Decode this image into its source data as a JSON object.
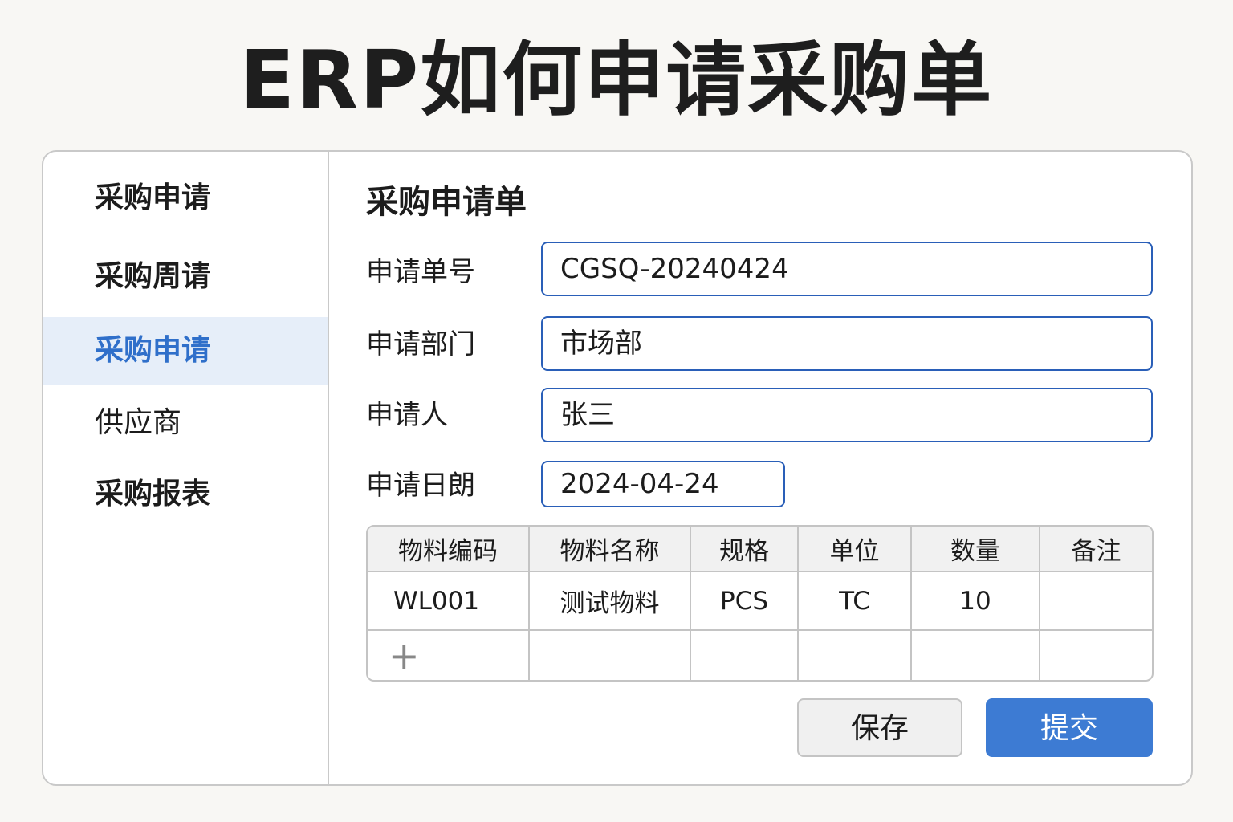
{
  "title": "ERP如何申请采购单",
  "sidebar": {
    "items": [
      {
        "label": "采购申请"
      },
      {
        "label": "采购周请"
      },
      {
        "label": "采购申请"
      },
      {
        "label": "供应商"
      },
      {
        "label": "采购报表"
      }
    ],
    "active_index": 2
  },
  "form": {
    "title": "采购申请单",
    "fields": [
      {
        "label": "申请单号",
        "value": "CGSQ-20240424"
      },
      {
        "label": "申请部门",
        "value": "市场部"
      },
      {
        "label": "申请人",
        "value": "张三"
      },
      {
        "label": "申请日朗",
        "value": "2024-04-24"
      }
    ],
    "table": {
      "headers": [
        "物料编码",
        "物料名称",
        "规格",
        "单位",
        "数量",
        "备注"
      ],
      "rows": [
        [
          "WL001",
          "测试物料",
          "PCS",
          "TC",
          "10",
          ""
        ]
      ],
      "add_icon": "plus-icon"
    },
    "save_label": "保存",
    "submit_label": "提交"
  },
  "colors": {
    "accent": "#3d7bd3",
    "active_bg": "#e6eef9",
    "input_border": "#2a5fb8"
  }
}
